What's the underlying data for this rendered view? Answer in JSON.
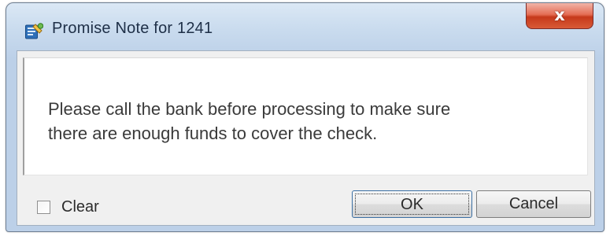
{
  "window": {
    "title": "Promise Note for 1241",
    "close_glyph": "x",
    "app_icon": "blue-note-icon"
  },
  "message": {
    "line1": "Please call the bank before processing to make sure",
    "line2": "there are enough funds to cover the check."
  },
  "footer": {
    "clear_label": "Clear",
    "clear_checked": false,
    "ok_label": "OK",
    "cancel_label": "Cancel"
  },
  "colors": {
    "title_bar": "#c9dbee",
    "close_button": "#d85a37",
    "client_background": "#f0f0f0",
    "message_background": "#ffffff"
  }
}
